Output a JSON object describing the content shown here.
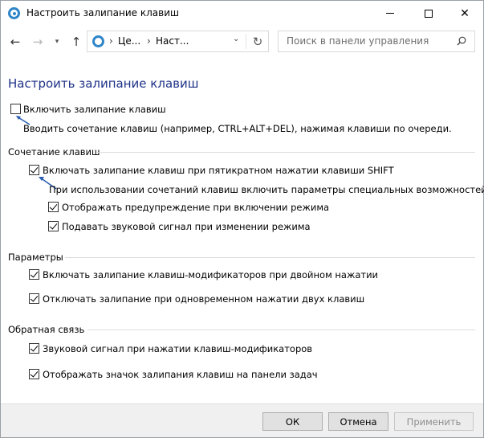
{
  "window": {
    "title": "Настроить залипание клавиш"
  },
  "navigation": {
    "breadcrumb": [
      "Це...",
      "Наст..."
    ],
    "search_placeholder": "Поиск в панели управления"
  },
  "page": {
    "title": "Настроить залипание клавиш",
    "main_option": {
      "label": "Включить залипание клавиш",
      "checked": false
    },
    "main_description": "Вводить сочетание клавиш (например, CTRL+ALT+DEL), нажимая клавиши по очереди.",
    "sections": {
      "shortcut": {
        "title": "Сочетание клавиш",
        "shift_option": {
          "label": "Включать залипание клавиш при пятикратном нажатии клавиши SHIFT",
          "checked": true
        },
        "sub_heading": "При использовании сочетаний клавиш включить параметры специальных возможностей:",
        "warning_option": {
          "label": "Отображать предупреждение при включении режима",
          "checked": true
        },
        "sound_option": {
          "label": "Подавать звуковой сигнал при изменении режима",
          "checked": true
        }
      },
      "options": {
        "title": "Параметры",
        "double_press_option": {
          "label": "Включать залипание клавиш-модификаторов при двойном нажатии",
          "checked": true
        },
        "two_keys_option": {
          "label": "Отключать залипание при одновременном нажатии двух клавиш",
          "checked": true
        }
      },
      "feedback": {
        "title": "Обратная связь",
        "sound_signal_option": {
          "label": "Звуковой сигнал при нажатии клавиш-модификаторов",
          "checked": true
        },
        "taskbar_icon_option": {
          "label": "Отображать значок залипания клавиш на панели задач",
          "checked": true
        }
      }
    }
  },
  "footer": {
    "ok_label": "ОК",
    "cancel_label": "Отмена",
    "apply_label": "Применить"
  },
  "colors": {
    "title_blue": "#1e3287",
    "arrow_blue": "#2a5db0",
    "footer_bg": "#f0f0f0"
  }
}
